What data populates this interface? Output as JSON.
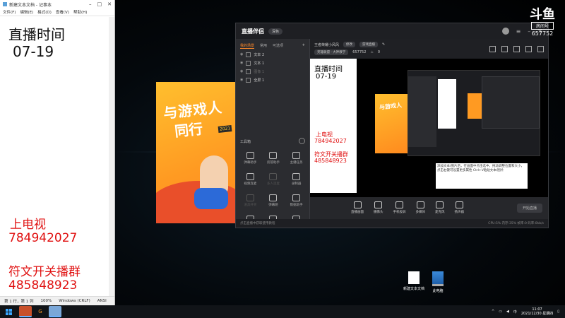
{
  "notepad": {
    "title": "新建文本文档 - 记事本",
    "menu": [
      "文件(F)",
      "编辑(E)",
      "格式(O)",
      "查看(V)",
      "帮助(H)"
    ],
    "lines": [
      "直播时间",
      "07-19",
      "上电视",
      "784942027",
      "符文开关播群",
      "485848923"
    ],
    "status": [
      "第 1 行，第 1 列",
      "100%",
      "Windows (CRLF)",
      "ANSI"
    ]
  },
  "poster": {
    "line1": "与游戏人",
    "line2": "同行",
    "badge": "2021"
  },
  "app": {
    "logo": "直播伴侣",
    "badge": "深色",
    "left_tabs": [
      "我的场景",
      "常用",
      "可选项",
      "+"
    ],
    "sources": [
      {
        "label": "文本 2",
        "dim": false
      },
      {
        "label": "文本 1",
        "dim": false
      },
      {
        "label": "图像 1",
        "dim": true
      },
      {
        "label": "全屏 1",
        "dim": false
      }
    ],
    "tools_title": "工具箱",
    "tools": [
      {
        "label": "弹幕助手",
        "dim": false
      },
      {
        "label": "房管助手",
        "dim": false
      },
      {
        "label": "主播任务",
        "dim": false
      },
      {
        "label": "视频连麦",
        "dim": false
      },
      {
        "label": "多人连麦",
        "dim": true
      },
      {
        "label": "录制器",
        "dim": false
      },
      {
        "label": "道具开奖",
        "dim": true
      },
      {
        "label": "弹幕姬",
        "dim": false
      },
      {
        "label": "数据助手",
        "dim": false
      },
      {
        "label": "互动玩法",
        "dim": false
      },
      {
        "label": "视频上传",
        "dim": false
      },
      {
        "label": "更多",
        "dim": false
      }
    ],
    "room_title": "王者荣耀小风风",
    "room_tag": "修改",
    "room_category": "游戏直播",
    "room_subcategory": "英雄联盟 · 大神教学",
    "room_id": "657752",
    "room_hot": "0",
    "preview_lines": [
      "直播时间",
      "07-19",
      "上电视",
      "784942027",
      "符文开关播群",
      "485848923"
    ],
    "tooltip": "添加文本/图片后，在画面中点击选中，拖动调整位置和大小，点击右键可设置更多属性 Ctrl+V粘贴文本/图片",
    "bottom_buttons": [
      "直播画面",
      "摄像头",
      "手机投屏",
      "多媒体",
      "麦克风",
      "扬声器"
    ],
    "live_button": "开始直播",
    "status_left": "点击直播中获取使用教程",
    "status_stats": "CPU:5%  内存:35%  帧率:0  码率:0kb/s"
  },
  "watermark": {
    "brand": "斗鱼",
    "label": "房间号",
    "room": "657752"
  },
  "desktop_icons": [
    "新建文本文档",
    "此电脑"
  ],
  "taskbar": {
    "time": "11:07",
    "date": "2021/12/30 星期四",
    "lang": "中"
  }
}
